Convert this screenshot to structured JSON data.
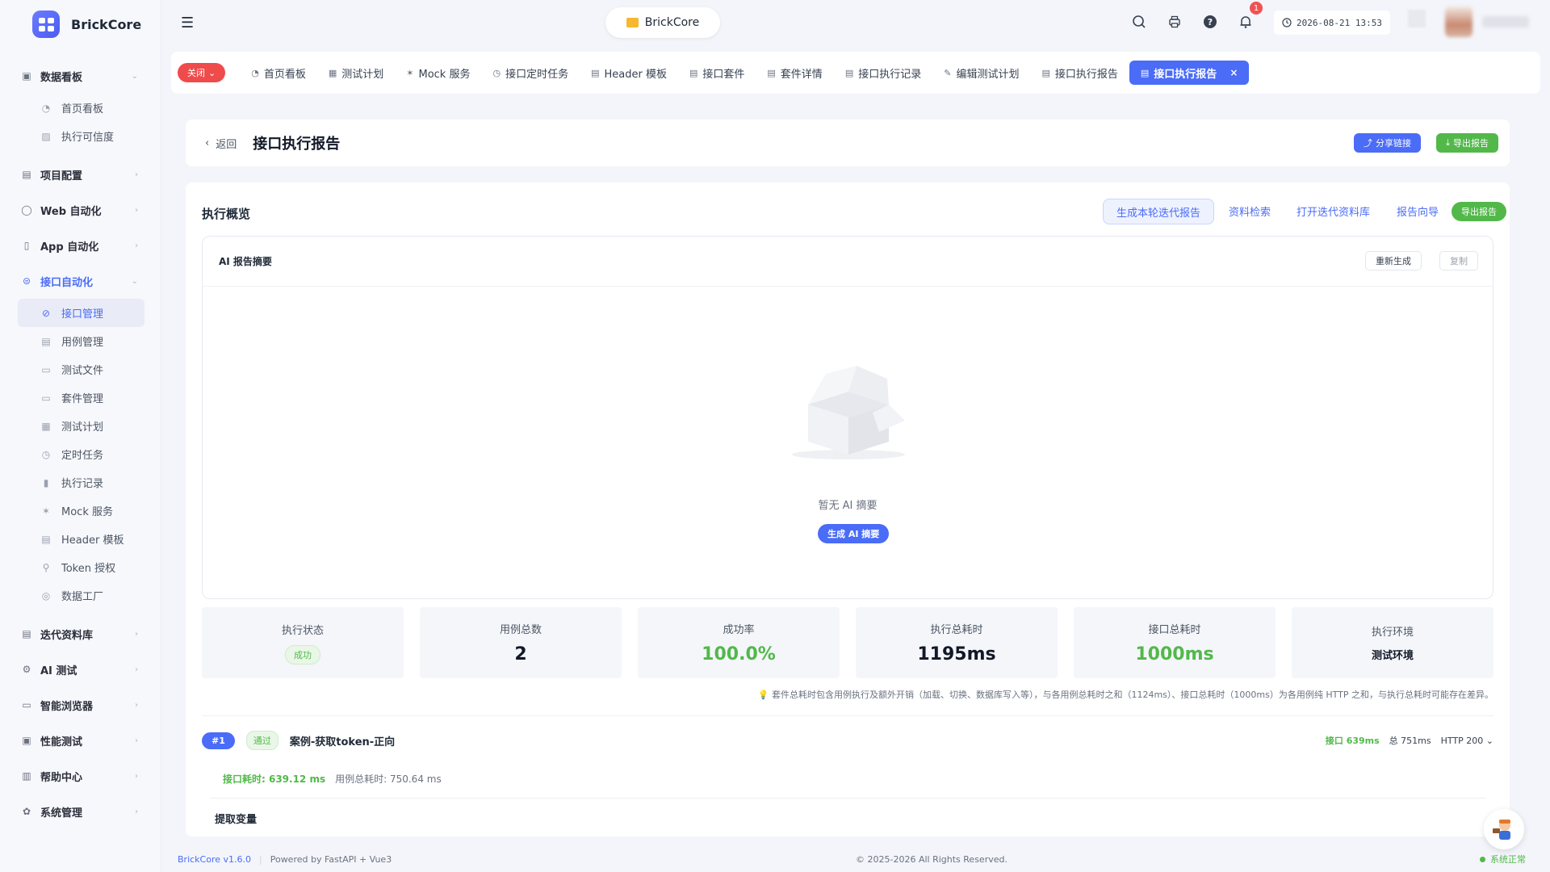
{
  "brand": {
    "name": "BrickCore"
  },
  "sidebar": {
    "groups": [
      {
        "label": "数据看板",
        "icon": "dashboard-icon",
        "open": true,
        "items": [
          {
            "label": "首页看板",
            "icon": "gauge-icon"
          },
          {
            "label": "执行可信度",
            "icon": "chart-icon"
          }
        ]
      },
      {
        "label": "项目配置",
        "icon": "settings-icon"
      },
      {
        "label": "Web 自动化",
        "icon": "web-icon"
      },
      {
        "label": "App 自动化",
        "icon": "phone-icon"
      },
      {
        "label": "接口自动化",
        "icon": "api-icon",
        "open": true,
        "active": true,
        "items": [
          {
            "label": "接口管理",
            "icon": "link-icon",
            "selected": true
          },
          {
            "label": "用例管理",
            "icon": "document-icon"
          },
          {
            "label": "测试文件",
            "icon": "folder-open-icon"
          },
          {
            "label": "套件管理",
            "icon": "folder-icon"
          },
          {
            "label": "测试计划",
            "icon": "calendar-icon"
          },
          {
            "label": "定时任务",
            "icon": "timer-icon"
          },
          {
            "label": "执行记录",
            "icon": "bar-chart-icon"
          },
          {
            "label": "Mock 服务",
            "icon": "mock-icon"
          },
          {
            "label": "Header 模板",
            "icon": "template-icon"
          },
          {
            "label": "Token 授权",
            "icon": "key-icon"
          },
          {
            "label": "数据工厂",
            "icon": "database-icon"
          }
        ]
      },
      {
        "label": "迭代资料库",
        "icon": "library-icon"
      },
      {
        "label": "AI 测试",
        "icon": "ai-icon"
      },
      {
        "label": "智能浏览器",
        "icon": "monitor-icon"
      },
      {
        "label": "性能测试",
        "icon": "performance-icon"
      },
      {
        "label": "帮助中心",
        "icon": "book-icon"
      },
      {
        "label": "系统管理",
        "icon": "gear-icon"
      }
    ]
  },
  "topbar": {
    "project": "BrickCore",
    "notification_count": "1",
    "datetime": "2026-08-21 13:53"
  },
  "tabs": {
    "close_label": "关闭",
    "items": [
      {
        "label": "首页看板",
        "icon": "gauge-icon"
      },
      {
        "label": "测试计划",
        "icon": "calendar-icon"
      },
      {
        "label": "Mock 服务",
        "icon": "mock-icon"
      },
      {
        "label": "接口定时任务",
        "icon": "alarm-icon"
      },
      {
        "label": "Header 模板",
        "icon": "document-icon"
      },
      {
        "label": "接口套件",
        "icon": "document-icon"
      },
      {
        "label": "套件详情",
        "icon": "document-icon"
      },
      {
        "label": "接口执行记录",
        "icon": "document-icon"
      },
      {
        "label": "编辑测试计划",
        "icon": "edit-icon"
      },
      {
        "label": "接口执行报告",
        "icon": "report-icon"
      },
      {
        "label": "接口执行报告",
        "icon": "report-icon",
        "active": true
      }
    ]
  },
  "header": {
    "back": "返回",
    "title": "接口执行报告",
    "share": "分享链接",
    "export": "导出报告"
  },
  "overview": {
    "title": "执行概览",
    "generate_iteration": "生成本轮迭代报告",
    "search": "资料检索",
    "open_library": "打开迭代资料库",
    "wizard": "报告向导",
    "export": "导出报告"
  },
  "ai_summary": {
    "title": "AI 报告摘要",
    "regenerate": "重新生成",
    "copy": "复制",
    "empty": "暂无 AI 摘要",
    "generate": "生成 AI 摘要"
  },
  "stats": [
    {
      "label": "执行状态",
      "value": "成功",
      "kind": "pill"
    },
    {
      "label": "用例总数",
      "value": "2",
      "kind": "num"
    },
    {
      "label": "成功率",
      "value": "100.0%",
      "kind": "green"
    },
    {
      "label": "执行总耗时",
      "value": "1195ms",
      "kind": "num"
    },
    {
      "label": "接口总耗时",
      "value": "1000ms",
      "kind": "green"
    },
    {
      "label": "执行环境",
      "value": "测试环境",
      "kind": "small"
    }
  ],
  "note": "💡 套件总耗时包含用例执行及额外开销（加载、切换、数据库写入等），与各用例总耗时之和（1124ms）、接口总耗时（1000ms）为各用例纯 HTTP 之和，与执行总耗时可能存在差异。",
  "case": {
    "index": "#1",
    "status": "通过",
    "name": "案例-获取token-正向",
    "api_time": "接口 639ms",
    "total_time": "总 751ms",
    "http": "HTTP 200",
    "api_detail": "接口耗时: 639.12 ms",
    "case_detail": "用例总耗时: 750.64 ms"
  },
  "extract_title": "提取变量",
  "footer": {
    "version": "BrickCore v1.6.0",
    "powered": "Powered by FastAPI + Vue3",
    "copyright": "© 2025-2026 All Rights Reserved.",
    "status": "系统正常"
  },
  "colors": {
    "primary": "#4a6cf7",
    "success": "#52b84a",
    "danger": "#ef4b4b"
  }
}
